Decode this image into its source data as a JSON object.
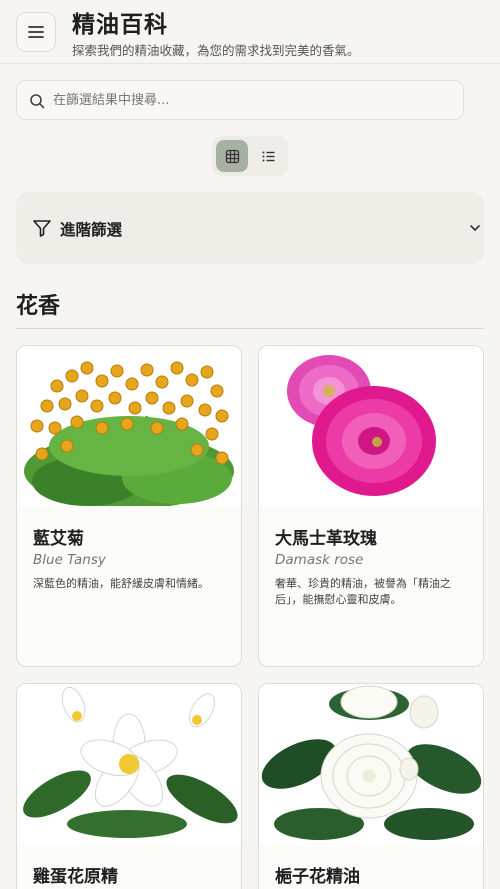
{
  "header": {
    "title": "精油百科",
    "subtitle": "探索我們的精油收藏，為您的需求找到完美的香氣。",
    "menu_icon": "hamburger-menu-icon"
  },
  "search": {
    "placeholder": "在篩選結果中搜尋...",
    "value": "",
    "icon": "search-icon"
  },
  "view_toggle": {
    "options": [
      "grid-view-icon",
      "list-view-icon"
    ],
    "selected": "grid"
  },
  "filter": {
    "label": "進階篩選",
    "icon": "filter-funnel-icon",
    "expanded": false
  },
  "section": {
    "title": "花香"
  },
  "oils": [
    {
      "name": "藍艾菊",
      "latin": "Blue Tansy",
      "description": "深藍色的精油，能舒緩皮膚和情緒。",
      "image": "blue-tansy-flower-image"
    },
    {
      "name": "大馬士革玫瑰",
      "latin": "Damask rose",
      "description": "奢華、珍貴的精油，被譽為「精油之后」，能撫慰心靈和皮膚。",
      "image": "damask-rose-flower-image"
    },
    {
      "name": "雞蛋花原精",
      "latin": "",
      "description": "",
      "image": "frangipani-flower-image"
    },
    {
      "name": "梔子花精油",
      "latin": "",
      "description": "",
      "image": "gardenia-flower-image"
    }
  ],
  "colors": {
    "background": "#f6f5f1",
    "accent_toggle": "#a7b0a3",
    "card_border": "#dedcd6"
  }
}
